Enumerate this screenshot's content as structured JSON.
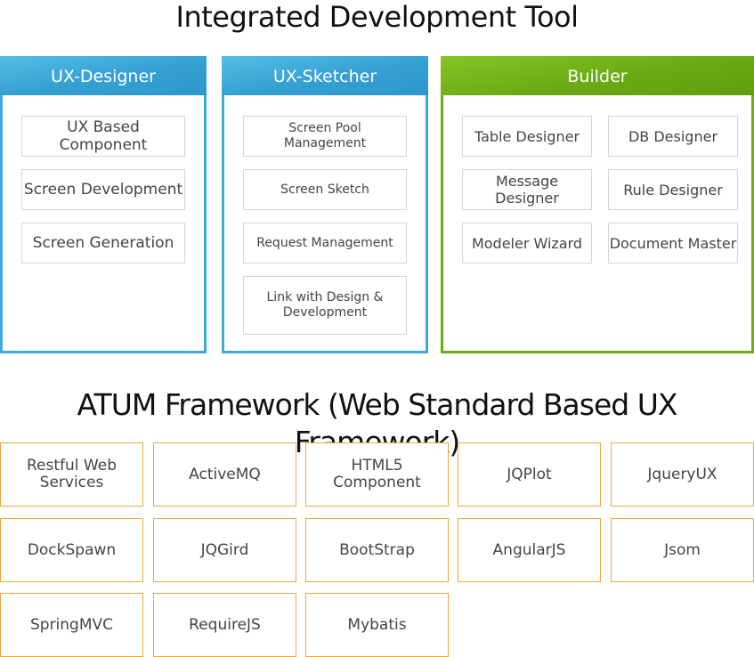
{
  "tool_title": "Integrated Development Tool",
  "framework_title": "ATUM Framework (Web Standard Based UX Framework)",
  "panels": {
    "ux_designer": {
      "title": "UX-Designer",
      "items": [
        "UX Based Component",
        "Screen Development",
        "Screen Generation"
      ]
    },
    "ux_sketcher": {
      "title": "UX-Sketcher",
      "items": [
        "Screen Pool Management",
        "Screen Sketch",
        "Request Management",
        "Link with Design & Development"
      ]
    },
    "builder": {
      "title": "Builder",
      "items": [
        "Table Designer",
        "DB Designer",
        "Message Designer",
        "Rule Designer",
        "Modeler Wizard",
        "Document Master"
      ]
    }
  },
  "framework_items": [
    "Restful Web Services",
    "ActiveMQ",
    "HTML5 Component",
    "JQPlot",
    "JqueryUX",
    "DockSpawn",
    "JQGird",
    "BootStrap",
    "AngularJS",
    "Jsom",
    "SpringMVC",
    "RequireJS",
    "Mybatis"
  ],
  "colors": {
    "designer_accent": "#3ea8d8",
    "builder_accent": "#6fab12",
    "framework_border": "#f0a640"
  }
}
